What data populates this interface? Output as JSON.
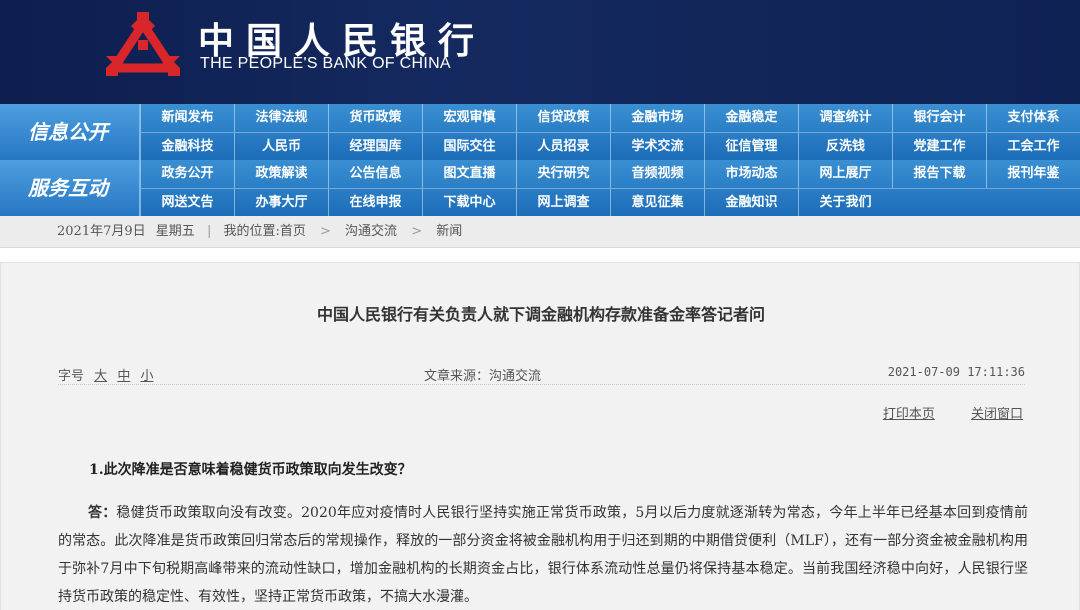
{
  "header": {
    "logo_cn": "中国人民银行",
    "logo_en": "THE PEOPLE'S BANK OF CHINA",
    "emblem_icon": "pboc-emblem-icon",
    "emblem_color": "#d8262a"
  },
  "nav": {
    "section1": {
      "heading": "信息公开",
      "row1": [
        "新闻发布",
        "法律法规",
        "货币政策",
        "宏观审慎",
        "信贷政策",
        "金融市场",
        "金融稳定",
        "调查统计",
        "银行会计",
        "支付体系"
      ],
      "row2": [
        "金融科技",
        "人民币",
        "经理国库",
        "国际交往",
        "人员招录",
        "学术交流",
        "征信管理",
        "反洗钱",
        "党建工作",
        "工会工作"
      ]
    },
    "section2": {
      "heading": "服务互动",
      "row1": [
        "政务公开",
        "政策解读",
        "公告信息",
        "图文直播",
        "央行研究",
        "音频视频",
        "市场动态",
        "网上展厅",
        "报告下载",
        "报刊年鉴"
      ],
      "row2": [
        "网送文告",
        "办事大厅",
        "在线申报",
        "下载中心",
        "网上调查",
        "意见征集",
        "金融知识",
        "关于我们"
      ]
    }
  },
  "breadcrumb": {
    "date": "2021年7月9日",
    "weekday": "星期五",
    "location_label": "我的位置:首页",
    "level1": "沟通交流",
    "level2": "新闻"
  },
  "article": {
    "title": "中国人民银行有关负责人就下调金融机构存款准备金率答记者问",
    "font_size_label": "字号",
    "font_large": "大",
    "font_medium": "中",
    "font_small": "小",
    "source": "文章来源：沟通交流",
    "datetime": "2021-07-09  17:11:36",
    "print_label": "打印本页",
    "close_label": "关闭窗口",
    "question1": "1.此次降准是否意味着稳健货币政策取向发生改变？",
    "answer_prefix": "答：",
    "answer1": "稳健货币政策取向没有改变。2020年应对疫情时人民银行坚持实施正常货币政策，5月以后力度就逐渐转为常态，今年上半年已经基本回到疫情前的常态。此次降准是货币政策回归常态后的常规操作，释放的一部分资金将被金融机构用于归还到期的中期借贷便利（MLF），还有一部分资金被金融机构用于弥补7月中下旬税期高峰带来的流动性缺口，增加金融机构的长期资金占比，银行体系流动性总量仍将保持基本稳定。当前我国经济稳中向好，人民银行坚持货币政策的稳定性、有效性，坚持正常货币政策，不搞大水漫灌。"
  }
}
